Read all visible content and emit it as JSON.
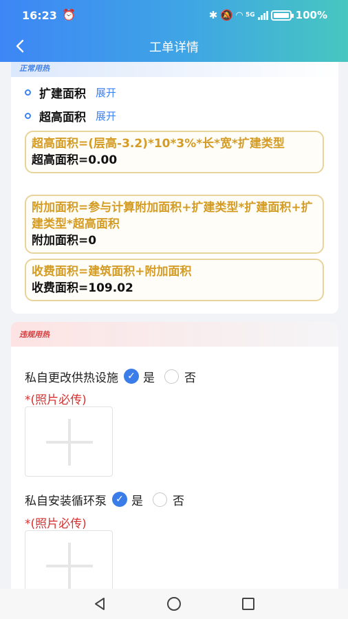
{
  "status": {
    "time": "16:23",
    "battery": "100%",
    "network": "5G"
  },
  "header": {
    "title": "工单详情"
  },
  "section1": {
    "label": "正常用热",
    "rows": [
      {
        "label": "扩建面积",
        "action": "展开"
      },
      {
        "label": "超高面积",
        "action": "展开"
      }
    ],
    "formulas": [
      {
        "title": "超高面积=(层高-3.2)*10*3%*长*宽*扩建类型",
        "value": "超高面积=0.00"
      },
      {
        "title": "附加面积=参与计算附加面积+扩建类型*扩建面积+扩建类型*超高面积",
        "value": "附加面积=0"
      },
      {
        "title": "收费面积=建筑面积+附加面积",
        "value": "收费面积=109.02"
      }
    ]
  },
  "section2": {
    "label": "违规用热",
    "questions": [
      {
        "label": "私自更改供热设施",
        "yes": "是",
        "no": "否",
        "selected": "yes",
        "required_note": "*(照片必传)"
      },
      {
        "label": "私自安装循环泵",
        "yes": "是",
        "no": "否",
        "selected": "yes",
        "required_note": "*(照片必传)"
      }
    ]
  },
  "colors": {
    "accent": "#3b82f6",
    "formula_border": "#e8d49a",
    "formula_title": "#d49c24",
    "required": "#d92f2f"
  }
}
